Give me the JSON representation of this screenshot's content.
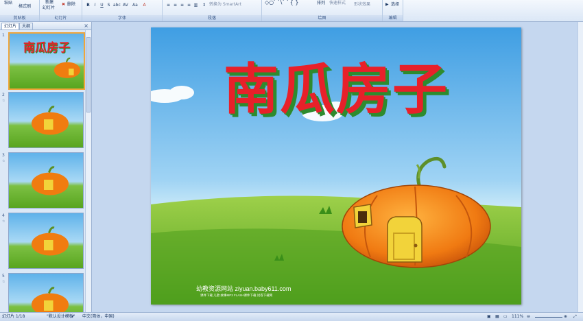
{
  "ribbon": {
    "clipboard": {
      "paste": "粘贴",
      "format_painter": "格式刷",
      "group": "剪贴板"
    },
    "slides": {
      "new_slide": "新建",
      "new_slide2": "幻灯片",
      "delete": "删除",
      "group": "幻灯片"
    },
    "font": {
      "group": "字体"
    },
    "paragraph": {
      "group": "段落",
      "smartart": "转换为 SmartArt"
    },
    "drawing": {
      "arrange": "排列",
      "quick_styles": "快速样式",
      "shape_effects": "形状效果",
      "group": "绘图"
    },
    "editing": {
      "select": "选择",
      "group": "编辑"
    }
  },
  "leftpane": {
    "tab_slides": "幻灯片",
    "tab_outline": "大纲",
    "close": "×",
    "slide_numbers": [
      "1",
      "2",
      "3",
      "4",
      "5"
    ],
    "thumb_title": "南瓜房子"
  },
  "slide": {
    "title": "南瓜房子",
    "footer_site": "幼教资源网站  ziyuan.baby611.com",
    "footer_sub": "课件下载   儿歌  故事MP3   FLASH课件下载   试卷下载网",
    "colors": {
      "title_red": "#e8202a",
      "title_green": "#2e8b2e",
      "sky": "#4fa9e6",
      "grass": "#6fbf2e"
    }
  },
  "status": {
    "slide_info": "幻灯片 1/18",
    "theme": "\"默认设计模板\"",
    "language": "中文(简体，中国)",
    "zoom": "111%"
  }
}
